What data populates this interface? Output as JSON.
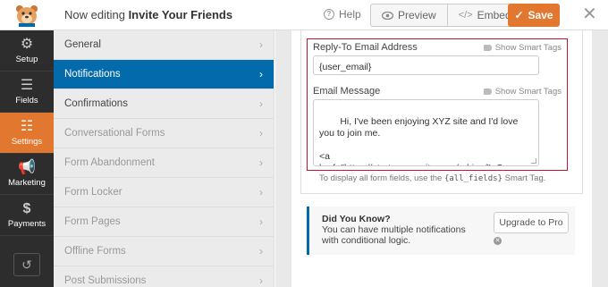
{
  "header": {
    "editing_prefix": "Now editing",
    "form_name": "Invite Your Friends",
    "help_label": "Help",
    "preview_label": "Preview",
    "embed_label": "Embed",
    "save_label": "Save",
    "brand_color": "#e27730"
  },
  "rail": {
    "items": [
      {
        "label": "Setup",
        "icon": "gear-icon"
      },
      {
        "label": "Fields",
        "icon": "list-icon"
      },
      {
        "label": "Settings",
        "icon": "sliders-icon"
      },
      {
        "label": "Marketing",
        "icon": "megaphone-icon"
      },
      {
        "label": "Payments",
        "icon": "dollar-icon"
      }
    ],
    "active": "Settings",
    "bottom_icon": "history-icon"
  },
  "menu": {
    "items": [
      {
        "label": "General",
        "state": "normal"
      },
      {
        "label": "Notifications",
        "state": "active"
      },
      {
        "label": "Confirmations",
        "state": "normal"
      },
      {
        "label": "Conversational Forms",
        "state": "muted"
      },
      {
        "label": "Form Abandonment",
        "state": "muted"
      },
      {
        "label": "Form Locker",
        "state": "muted"
      },
      {
        "label": "Form Pages",
        "state": "muted"
      },
      {
        "label": "Offline Forms",
        "state": "muted"
      },
      {
        "label": "Post Submissions",
        "state": "muted"
      }
    ],
    "active_color": "#036aab"
  },
  "notification": {
    "reply_to": {
      "label": "Reply-To Email Address",
      "smart_tags": "Show Smart Tags",
      "value": "{user_email}"
    },
    "message": {
      "label": "Email Message",
      "smart_tags": "Show Smart Tags",
      "value": "Hi, I've been enjoying XYZ site and I'd love you to join me.\n\n<a href=\"https://startyourwpsite.com/adrian/\">Come and check it out</a>. I think you'll love it too!\n\n{user_first_name}"
    },
    "hint_prefix": "To display all form fields, use the",
    "hint_code": "{all_fields}",
    "hint_suffix": "Smart Tag.",
    "highlight_color": "#c8102e"
  },
  "did_you_know": {
    "title": "Did You Know?",
    "text": "You can have multiple notifications with conditional logic.",
    "upgrade_label": "Upgrade to Pro"
  }
}
